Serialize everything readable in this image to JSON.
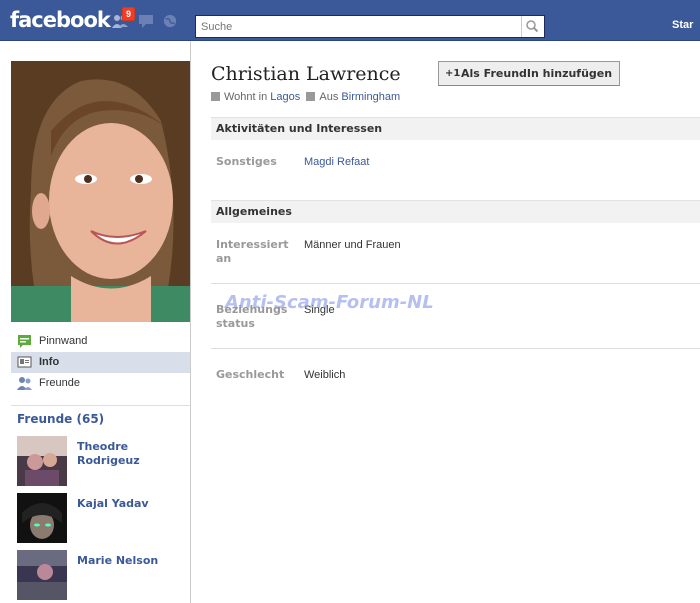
{
  "topbar": {
    "logo": "facebook",
    "friend_requests_badge": "9",
    "search": {
      "placeholder": "Suche"
    },
    "start_link": "Star"
  },
  "sidebar": {
    "nav": [
      {
        "label": "Pinnwand",
        "icon": "wall-icon"
      },
      {
        "label": "Info",
        "icon": "info-icon",
        "active": true
      },
      {
        "label": "Freunde",
        "icon": "friends-icon"
      }
    ],
    "friends_header": "Freunde (65)",
    "friends": [
      {
        "name": "Theodre Rodrigeuz"
      },
      {
        "name": "Kajal Yadav"
      },
      {
        "name": "Marie Nelson"
      }
    ]
  },
  "profile": {
    "name": "Christian Lawrence",
    "add_friend_label": "Als FreundIn hinzufügen",
    "lives_in_prefix": "Wohnt in",
    "lives_in": "Lagos",
    "from_prefix": "Aus",
    "from": "Birmingham"
  },
  "sections": {
    "activities": {
      "title": "Aktivitäten und Interessen",
      "rows": [
        {
          "label": "Sonstiges",
          "value": "Magdi Refaat"
        }
      ]
    },
    "general": {
      "title": "Allgemeines",
      "rows": [
        {
          "label": "Interessiert an",
          "value": "Männer und Frauen"
        },
        {
          "label": "Beziehungs status",
          "value": "Single"
        },
        {
          "label": "Geschlecht",
          "value": "Weiblich"
        }
      ]
    }
  },
  "watermark": "Anti-Scam-Forum-NL",
  "colors": {
    "brand": "#3b5998",
    "badge": "#f03d25",
    "nav_active": "#d8dfea"
  }
}
